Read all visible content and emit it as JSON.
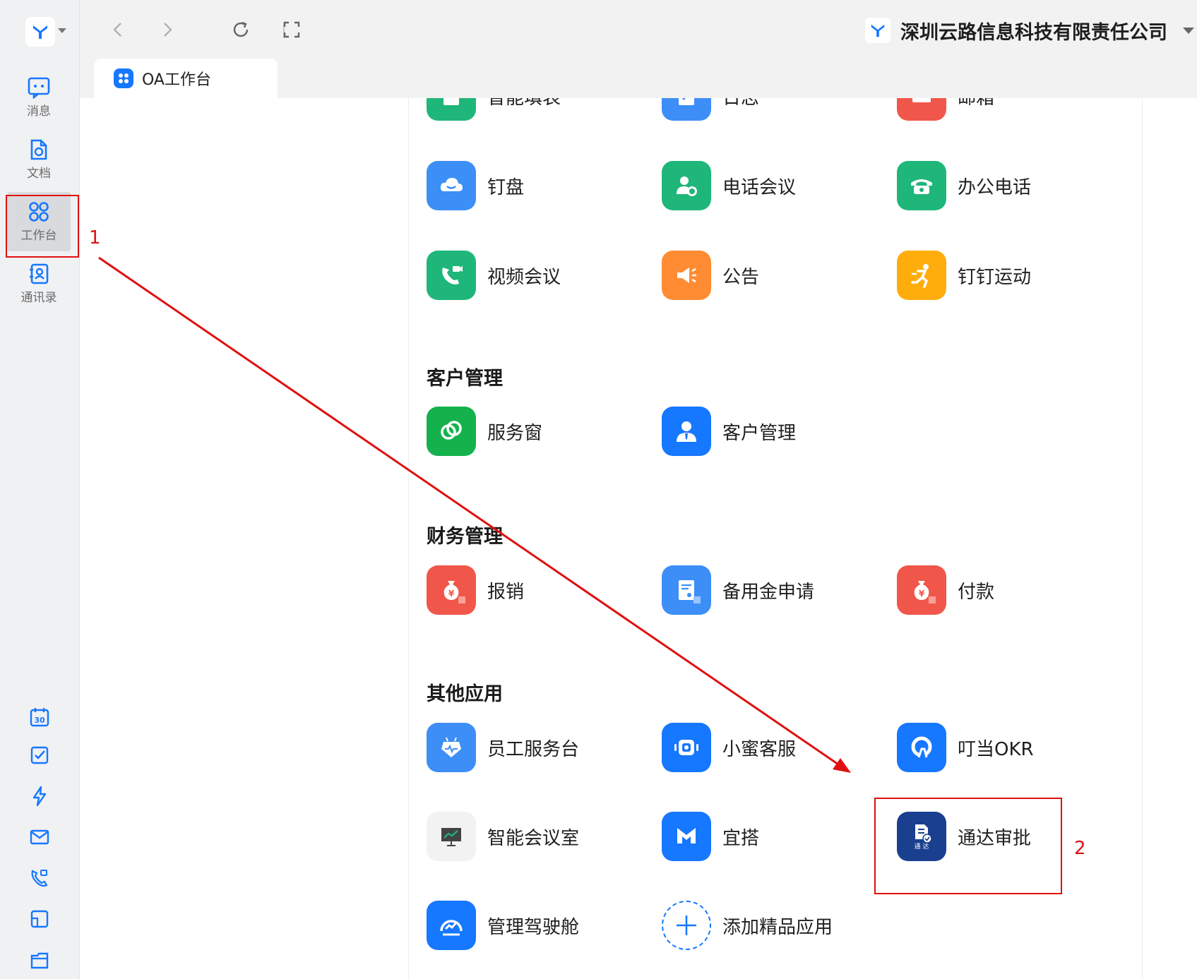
{
  "company": {
    "name": "深圳云路信息科技有限责任公司"
  },
  "tab": {
    "label": "OA工作台"
  },
  "rail": {
    "items": [
      {
        "label": "消息"
      },
      {
        "label": "文档"
      },
      {
        "label": "工作台"
      },
      {
        "label": "通讯录"
      }
    ]
  },
  "apps_top_partial": [
    {
      "label": "智能填表",
      "icon": "form-icon",
      "color": "#1fb67a"
    },
    {
      "label": "日志",
      "icon": "log-icon",
      "color": "#3d8ef7"
    },
    {
      "label": "邮箱",
      "icon": "mail-icon",
      "color": "#f0574a"
    }
  ],
  "apps_row1": [
    {
      "label": "钉盘",
      "icon": "cloud-drive-icon",
      "color": "#3b8ff6"
    },
    {
      "label": "电话会议",
      "icon": "phone-conference-icon",
      "color": "#1fb67a"
    },
    {
      "label": "办公电话",
      "icon": "office-phone-icon",
      "color": "#1fb67a"
    }
  ],
  "apps_row2": [
    {
      "label": "视频会议",
      "icon": "video-meeting-icon",
      "color": "#1fb67a"
    },
    {
      "label": "公告",
      "icon": "announcement-icon",
      "color": "#ff8c32"
    },
    {
      "label": "钉钉运动",
      "icon": "sport-icon",
      "color": "#ffad0d"
    }
  ],
  "sections": {
    "customer": {
      "title": "客户管理",
      "apps": [
        {
          "label": "服务窗",
          "icon": "service-window-icon",
          "color": "#14b14d"
        },
        {
          "label": "客户管理",
          "icon": "customer-icon",
          "color": "#1677ff"
        }
      ]
    },
    "finance": {
      "title": "财务管理",
      "apps": [
        {
          "label": "报销",
          "icon": "reimburse-icon",
          "color": "#f0574a"
        },
        {
          "label": "备用金申请",
          "icon": "petty-cash-icon",
          "color": "#3d8ef7"
        },
        {
          "label": "付款",
          "icon": "payment-icon",
          "color": "#f0574a"
        }
      ]
    },
    "other": {
      "title": "其他应用",
      "apps": [
        {
          "label": "员工服务台",
          "icon": "service-desk-icon",
          "color": "#3d8ef7"
        },
        {
          "label": "小蜜客服",
          "icon": "ai-service-icon",
          "color": "#1677ff"
        },
        {
          "label": "叮当OKR",
          "icon": "okr-icon",
          "color": "#1677ff"
        },
        {
          "label": "智能会议室",
          "icon": "meeting-room-icon",
          "color": "#f2f2f2"
        },
        {
          "label": "宜搭",
          "icon": "yida-icon",
          "color": "#1677ff"
        },
        {
          "label": "通达审批",
          "icon": "tongda-approval-icon",
          "color": "#1a3f8f",
          "badge": "通 达"
        },
        {
          "label": "管理驾驶舱",
          "icon": "dashboard-icon",
          "color": "#1677ff"
        },
        {
          "label": "添加精品应用",
          "icon": "add-app-icon",
          "color": "#ffffff"
        }
      ]
    }
  },
  "annotations": {
    "n1": "1",
    "n2": "2",
    "color": "#e01010"
  }
}
